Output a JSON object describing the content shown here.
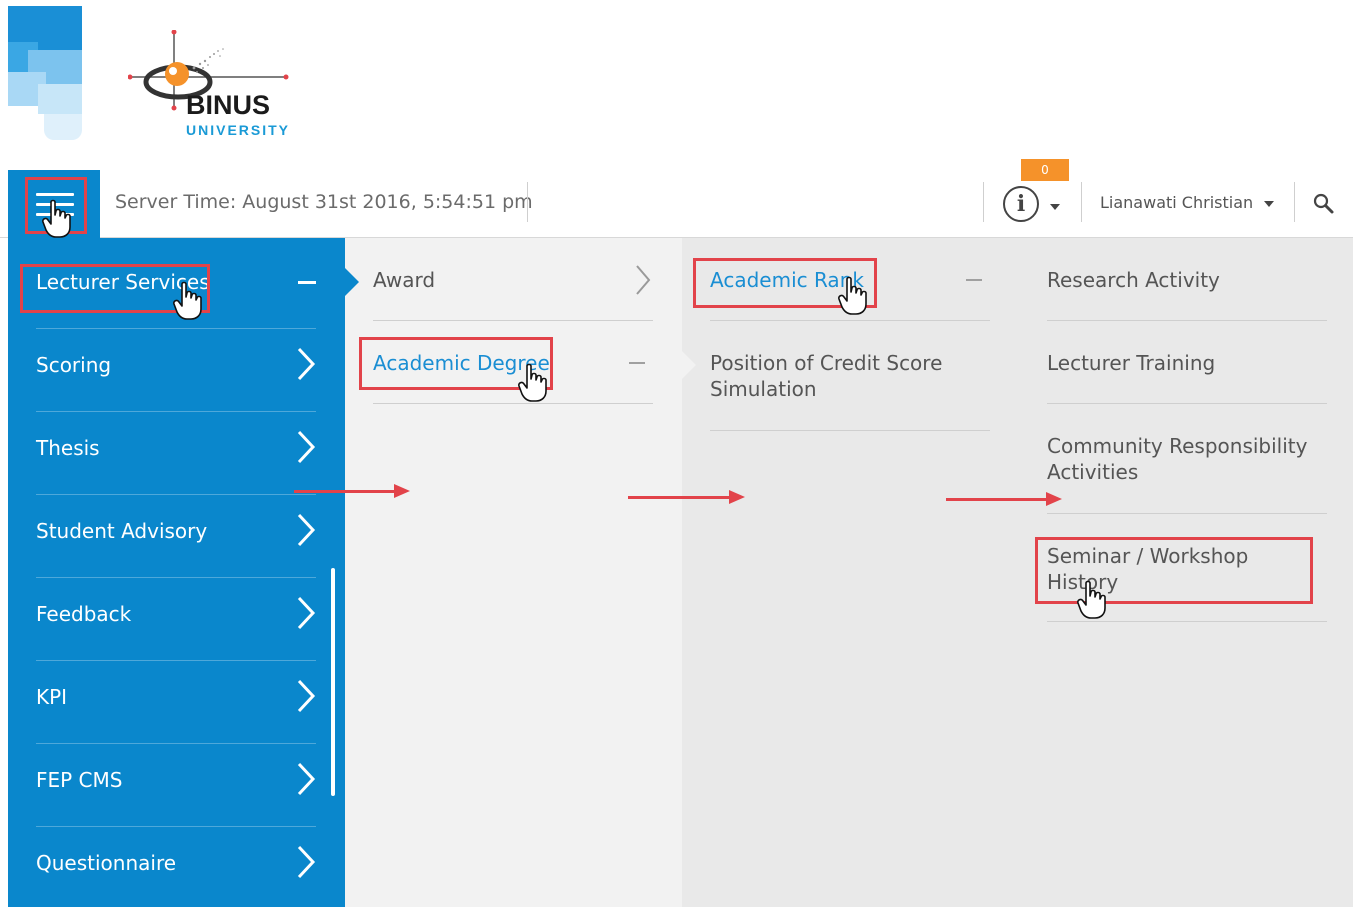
{
  "logo": {
    "name": "BINUS",
    "subtitle": "UNIVERSITY"
  },
  "header": {
    "server_time": "Server Time: August 31st 2016, 5:54:51 pm",
    "notification_count": "0",
    "info_glyph": "i",
    "user_name": "Lianawati Christian",
    "icons": [
      "hamburger-icon",
      "info-icon",
      "caret-down-icon",
      "search-icon"
    ]
  },
  "sidebar": {
    "items": [
      {
        "label": "Lecturer Services",
        "state": "expanded"
      },
      {
        "label": "Scoring"
      },
      {
        "label": "Thesis"
      },
      {
        "label": "Student Advisory"
      },
      {
        "label": "Feedback"
      },
      {
        "label": "KPI"
      },
      {
        "label": "FEP CMS"
      },
      {
        "label": "Questionnaire"
      }
    ]
  },
  "column2": {
    "items": [
      {
        "label": "Award"
      },
      {
        "label": "Academic Degree",
        "state": "expanded"
      }
    ]
  },
  "column3": {
    "items": [
      {
        "label": "Academic Rank",
        "state": "expanded"
      },
      {
        "label": "Position of Credit Score Simulation"
      }
    ]
  },
  "column4": {
    "items": [
      {
        "label": "Research Activity"
      },
      {
        "label": "Lecturer Training"
      },
      {
        "label": "Community Responsibility Activities"
      },
      {
        "label": "Seminar / Workshop History"
      }
    ]
  },
  "colors": {
    "brand_blue": "#0a87cc",
    "link_blue": "#1a8ed3",
    "badge_orange": "#f5922a",
    "annotation_red": "#e2434a"
  }
}
